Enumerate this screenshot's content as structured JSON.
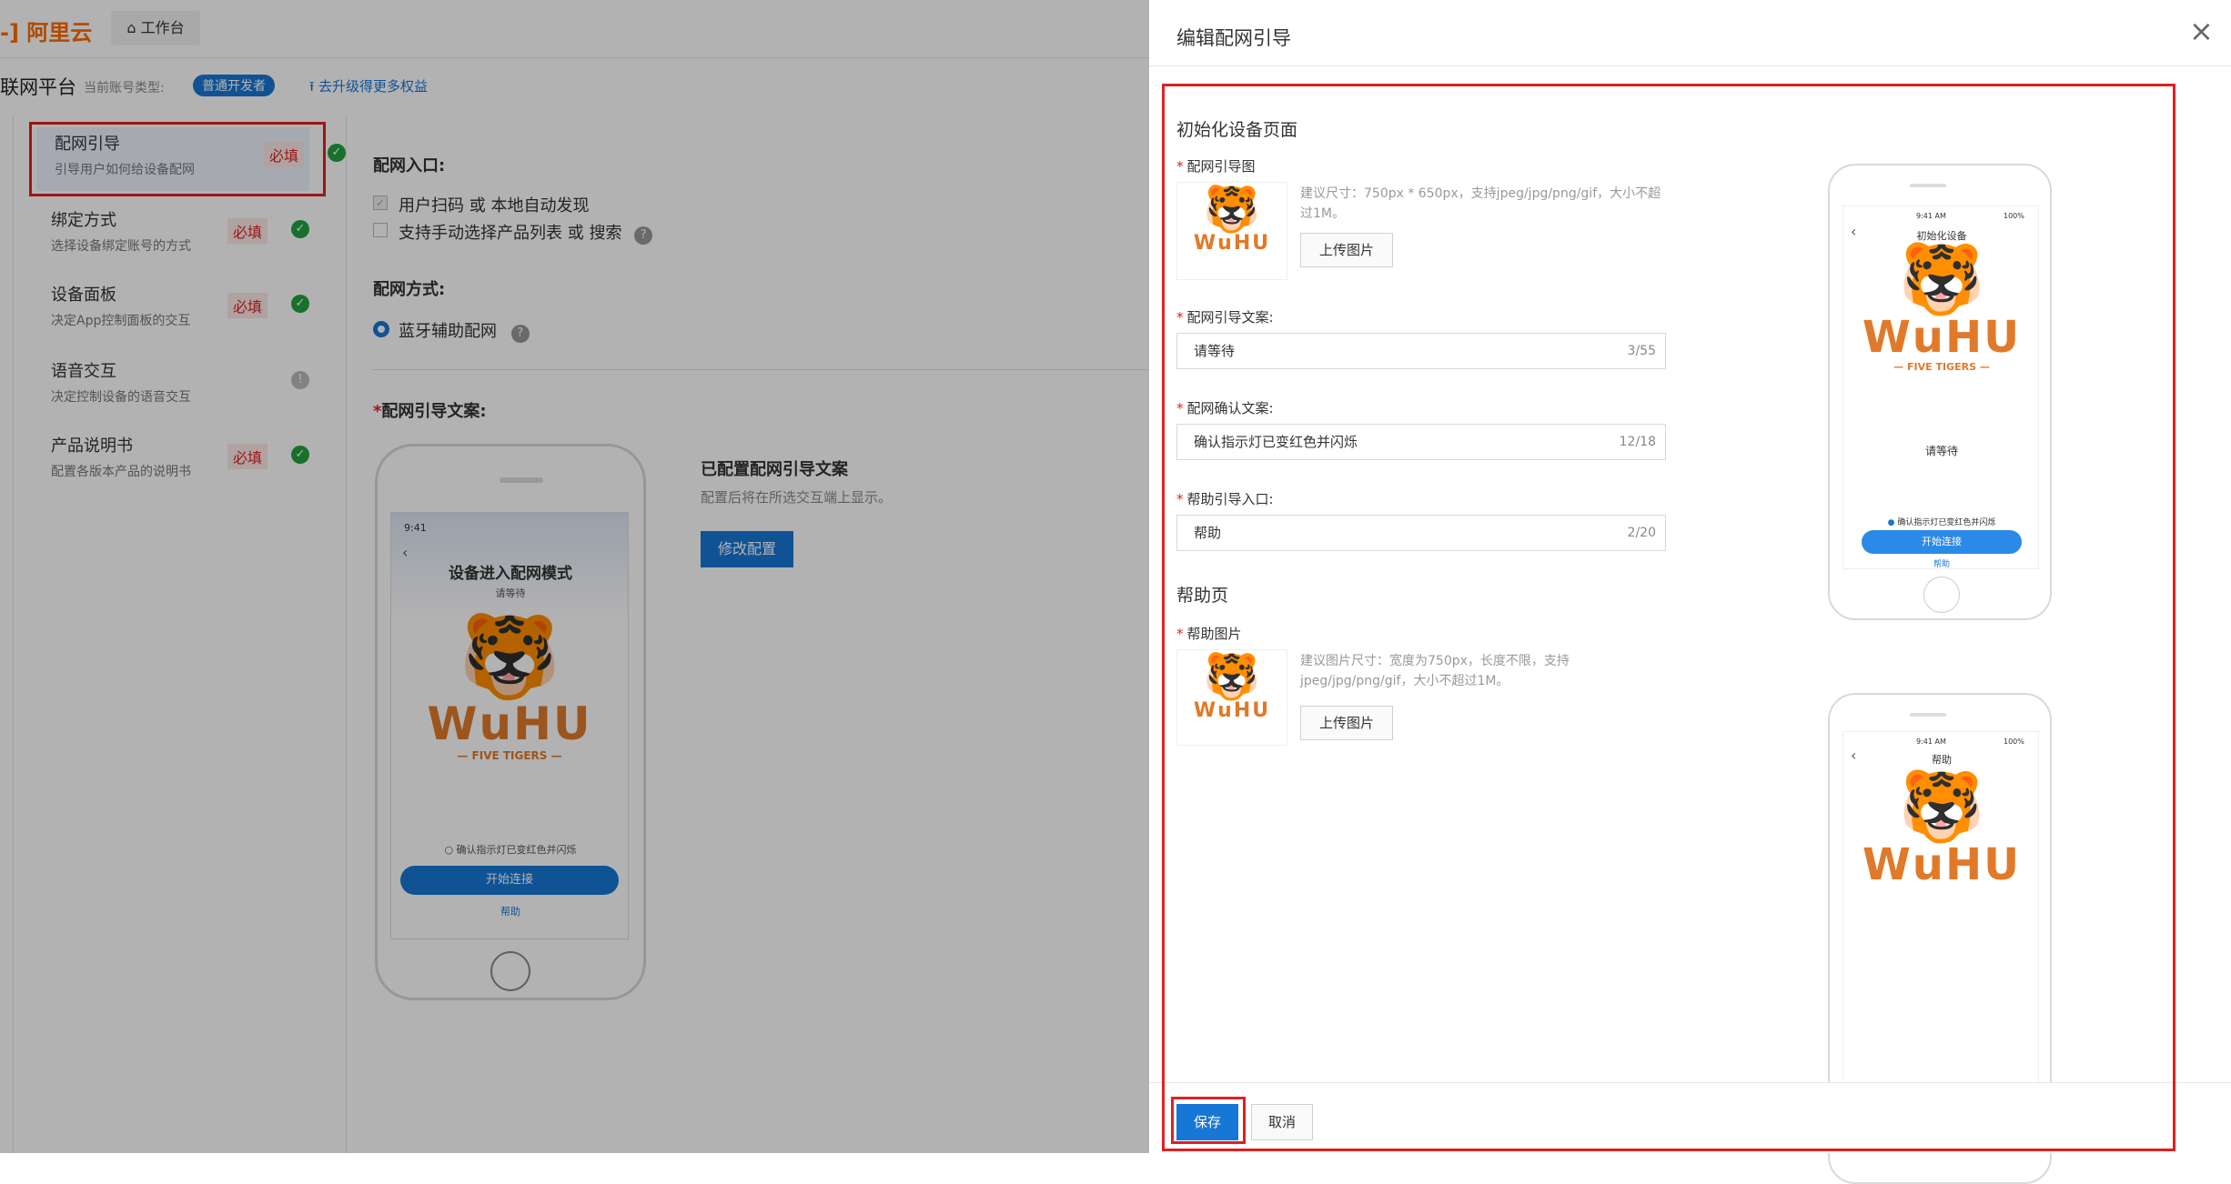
{
  "topbar": {
    "logo": "-] 阿里云",
    "home_tab": "工作台"
  },
  "platform": {
    "title": "联网平台",
    "account_label": "当前账号类型:",
    "account_badge": "普通开发者",
    "upgrade_link": "去升级得更多权益"
  },
  "sidebar": {
    "items": [
      {
        "title": "配网引导",
        "desc": "引导用户如何给设备配网",
        "tag": "必填",
        "status": "ok"
      },
      {
        "title": "绑定方式",
        "desc": "选择设备绑定账号的方式",
        "tag": "必填",
        "status": "ok"
      },
      {
        "title": "设备面板",
        "desc": "决定App控制面板的交互",
        "tag": "必填",
        "status": "ok"
      },
      {
        "title": "语音交互",
        "desc": "决定控制设备的语音交互",
        "tag": "",
        "status": "info"
      },
      {
        "title": "产品说明书",
        "desc": "配置各版本产品的说明书",
        "tag": "必填",
        "status": "ok"
      }
    ]
  },
  "main": {
    "entry_label": "配网入口:",
    "entry_options": [
      "用户扫码 或 本地自动发现",
      "支持手动选择产品列表 或 搜索"
    ],
    "method_label": "配网方式:",
    "method_option": "蓝牙辅助配网",
    "copy_label": "配网引导文案:",
    "configured_title": "已配置配网引导文案",
    "configured_desc": "配置后将在所选交互端上显示。",
    "modify_button": "修改配置",
    "phone": {
      "time": "9:41",
      "title": "设备进入配网模式",
      "subtitle": "请等待",
      "brand": "WuHU",
      "brand_sub": "— FIVE TIGERS —",
      "confirm": "确认指示灯已变红色并闪烁",
      "start": "开始连接",
      "help": "帮助"
    }
  },
  "drawer": {
    "title": "编辑配网引导",
    "section1": "初始化设备页面",
    "img_label": "配网引导图",
    "img_hint": "建议尺寸：750px * 650px，支持jpeg/jpg/png/gif，大小不超过1M。",
    "upload": "上传图片",
    "copy_label": "配网引导文案:",
    "copy_value": "请等待",
    "copy_count": "3/55",
    "confirm_label": "配网确认文案:",
    "confirm_value": "确认指示灯已变红色并闪烁",
    "confirm_count": "12/18",
    "help_label": "帮助引导入口:",
    "help_value": "帮助",
    "help_count": "2/20",
    "section2": "帮助页",
    "help_img_label": "帮助图片",
    "help_img_hint": "建议图片尺寸：宽度为750px，长度不限，支持jpeg/jpg/png/gif，大小不超过1M。",
    "upload2": "上传图片",
    "preview1": {
      "time": "9:41 AM",
      "battery": "100%",
      "title": "初始化设备",
      "subtitle": "请等待",
      "brand": "WuHU",
      "brand_sub": "— FIVE TIGERS —",
      "confirm": "确认指示灯已变红色并闪烁",
      "start": "开始连接",
      "help": "帮助"
    },
    "preview2": {
      "time": "9:41 AM",
      "battery": "100%",
      "title": "帮助",
      "brand": "WuHU"
    },
    "save": "保存",
    "cancel": "取消"
  },
  "colors": {
    "primary": "#1677d6",
    "required": "#e02020",
    "brand_orange": "#e07a2a",
    "success": "#22a33f"
  }
}
